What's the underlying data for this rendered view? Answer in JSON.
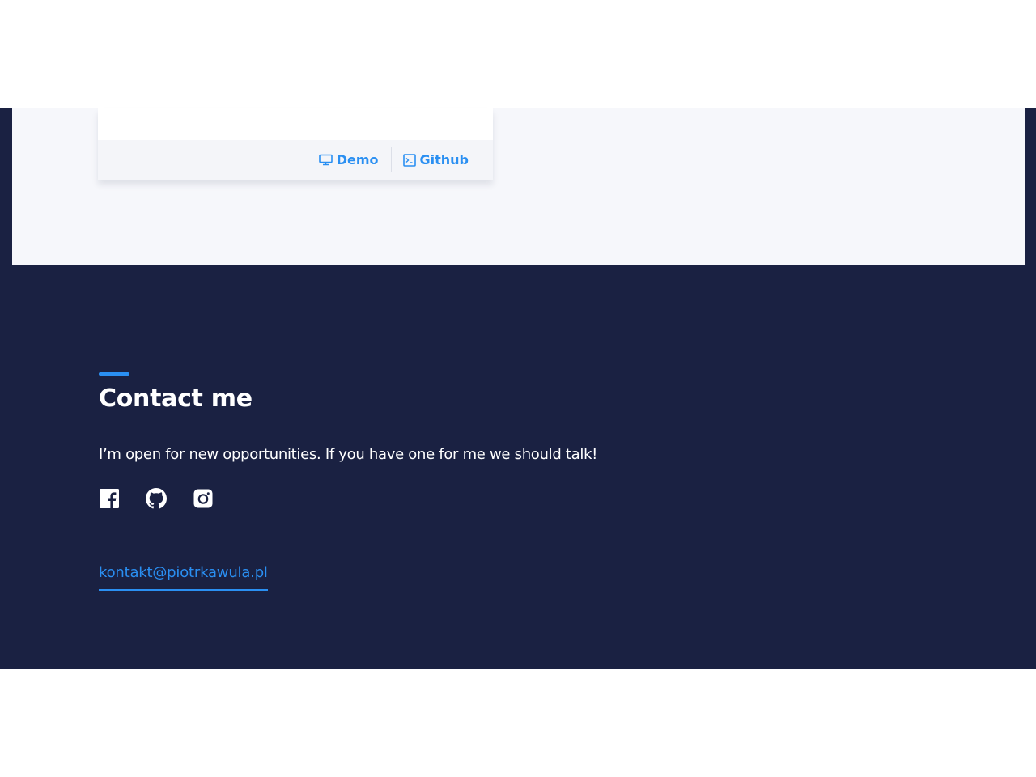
{
  "project_card": {
    "demo_label": "Demo",
    "demo_icon": "monitor-icon",
    "github_label": "Github",
    "github_icon": "terminal-icon"
  },
  "contact": {
    "title": "Contact me",
    "text": "I’m open for new opportunities. If you have one for me we should talk!",
    "socials": [
      {
        "icon": "facebook-icon"
      },
      {
        "icon": "github-icon"
      },
      {
        "icon": "instagram-icon"
      }
    ],
    "email": "kontakt@piotrkawula.pl"
  },
  "colors": {
    "navy_background": "#1a2142",
    "section_background": "#f6f7fb",
    "accent_blue": "#2a8ff2",
    "text_white": "#ffffff"
  }
}
